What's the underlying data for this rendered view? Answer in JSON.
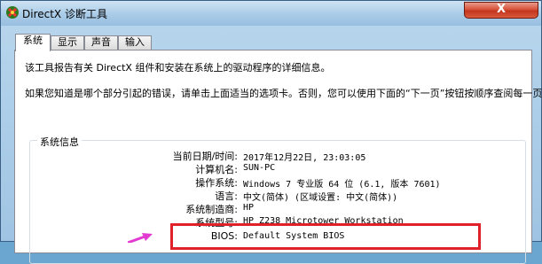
{
  "window": {
    "title": "DirectX 诊断工具",
    "close_glyph": "X"
  },
  "tabs": [
    {
      "label": "系统",
      "active": true
    },
    {
      "label": "显示",
      "active": false
    },
    {
      "label": "声音",
      "active": false
    },
    {
      "label": "输入",
      "active": false
    }
  ],
  "intro": {
    "line1": "该工具报告有关 DirectX 组件和安装在系统上的驱动程序的详细信息。",
    "line2": "如果您知道是哪个部分引起的错误，请单击上面适当的选项卡。否则，您可以使用下面的“下一页”按钮按顺序查阅每一页。"
  },
  "system_info": {
    "group_title": "系统信息",
    "rows": [
      {
        "label": "当前日期/时间:",
        "value": "2017年12月22日, 23:03:05"
      },
      {
        "label": "计算机名:",
        "value": "SUN-PC"
      },
      {
        "label": "操作系统:",
        "value": "Windows 7 专业版 64 位 (6.1, 版本 7601)"
      },
      {
        "label": "语言:",
        "value": "中文(简体) (区域设置: 中文(简体))"
      },
      {
        "label": "系统制造商:",
        "value": "HP"
      },
      {
        "label": "系统型号:",
        "value": "HP Z238 Microtower Workstation"
      },
      {
        "label": "BIOS:",
        "value": "Default System BIOS"
      }
    ]
  },
  "colors": {
    "highlight": "#e0212a",
    "arrow": "#e23bd2"
  }
}
